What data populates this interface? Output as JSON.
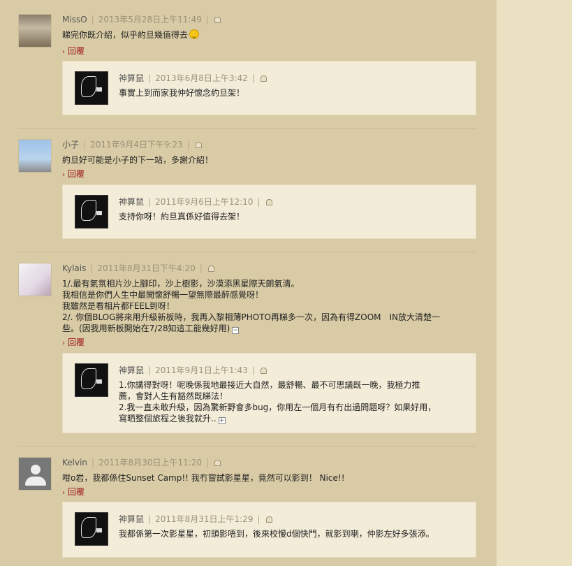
{
  "flag_label": "",
  "reply_label": "回覆",
  "comments": [
    {
      "author": "MissO",
      "date": "2013年5月28日上午11:49",
      "text": "睇完你既介紹，似乎約旦幾值得去",
      "reply": {
        "author": "神算鼠",
        "date": "2013年6月8日上午3:42",
        "text": "事實上到而家我仲好懷念約旦架！"
      }
    },
    {
      "author": "小子",
      "date": "2011年9月4日下午9:23",
      "text": "約旦好可能是小子的下一站，多謝介紹！",
      "reply": {
        "author": "神算鼠",
        "date": "2011年9月6日上午12:10",
        "text": "支持你呀！約旦真係好值得去架！"
      }
    },
    {
      "author": "Kylais",
      "date": "2011年8月31日下午4:20",
      "lines": [
        "1/.最有氣氛相片沙上腳印，沙上樹影，沙漠添黑星際天朗氣清。",
        "我相信是你們人生中最開懷舒暢一望無際最醉感覺呀！",
        "我雖然是看相片都FEEL到呀！",
        "2/. 你個BLOG將來用升級新板時，我再入黎相薄PHOTO再睇多一次，因為有得ZOOM　IN放大清楚一",
        "些。(因我用新板開始在7/28知這工能幾好用)"
      ],
      "reply": {
        "author": "神算鼠",
        "date": "2011年9月1日上午1:43",
        "lines": [
          "1.你講得對呀！呢晚係我地最接近大自然，最舒暢、最不可思議既一晚，我極力推",
          "薦，會對人生有豁然既睇法！",
          "2.我一直未敢升級，因為驚新野會多bug，你用左一個月有冇出過問題呀？如果好用，",
          "寫晒整個旅程之後我就升.."
        ]
      }
    },
    {
      "author": "Kelvin",
      "date": "2011年8月30日上午11:20",
      "text": "咁o岩，我都係住Sunset Camp!! 我冇嘗試影星星，竟然可以影到！ Nice!!",
      "reply": {
        "author": "神算鼠",
        "date": "2011年8月31日上午1:29",
        "text": "我都係第一次影星星，初頭影唔到，後來校慢d個快門，就影到喇，仲影左好多張添。"
      }
    }
  ]
}
